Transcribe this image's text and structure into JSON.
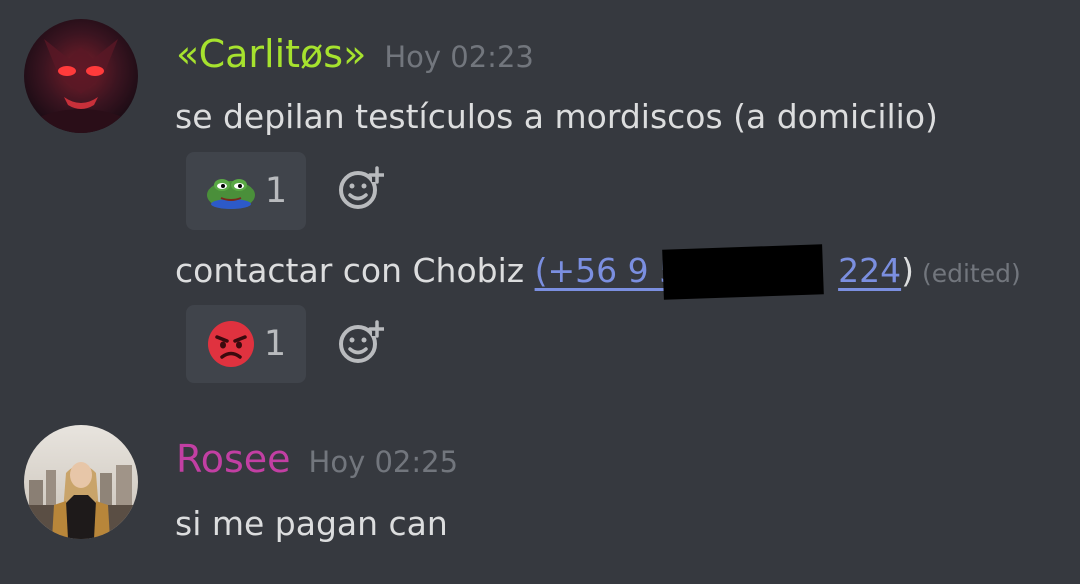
{
  "messages": [
    {
      "author": "«Carlitøs»",
      "author_color": "#a6e22e",
      "timestamp": "Hoy 02:23",
      "lines": [
        {
          "text": "se depilan testículos a mordiscos (a domicilio)",
          "reaction": {
            "emoji": "pepe-frog-icon",
            "count": "1"
          }
        },
        {
          "text": "contactar con Chobiz ",
          "phone": "(+56 9 5",
          "phone_end": "224",
          "after": ")",
          "edited": "(edited)",
          "reaction": {
            "emoji": "angry-face-icon",
            "count": "1"
          }
        }
      ]
    },
    {
      "author": "Rosee",
      "author_color": "#c23fa3",
      "timestamp": "Hoy 02:25",
      "lines": [
        {
          "text": "si me pagan can"
        }
      ]
    }
  ]
}
